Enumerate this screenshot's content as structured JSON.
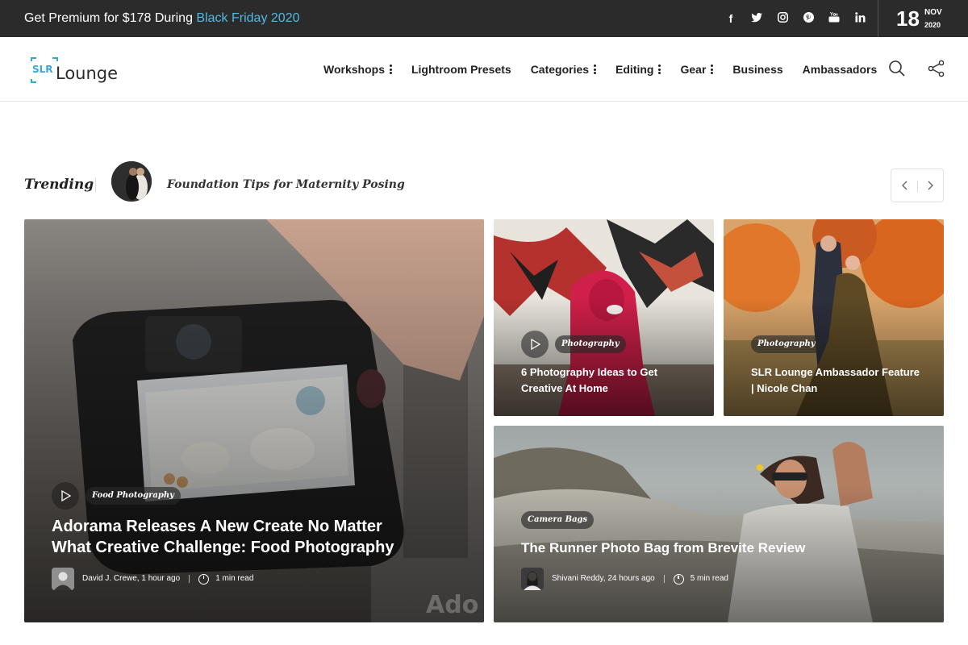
{
  "promo": {
    "text": "Get Premium for $178 During ",
    "highlight": "Black Friday 2020"
  },
  "social": [
    "facebook-icon",
    "twitter-icon",
    "instagram-icon",
    "pinterest-icon",
    "youtube-icon",
    "linkedin-icon"
  ],
  "date": {
    "day": "18",
    "month": "NOV",
    "year": "2020"
  },
  "logo": {
    "badge": "SLR",
    "word": "Lounge"
  },
  "nav": [
    {
      "label": "Workshops",
      "dropdown": true
    },
    {
      "label": "Lightroom Presets",
      "dropdown": false
    },
    {
      "label": "Categories",
      "dropdown": true
    },
    {
      "label": "Editing",
      "dropdown": true
    },
    {
      "label": "Gear",
      "dropdown": true
    },
    {
      "label": "Business",
      "dropdown": false
    },
    {
      "label": "Ambassadors",
      "dropdown": false
    }
  ],
  "trending": {
    "label": "Trending",
    "title": "Foundation Tips for Maternity Posing"
  },
  "cards": {
    "main": {
      "category": "Food Photography",
      "title_line1": "Adorama Releases A New Create No Matter",
      "title_line2": "What Creative Challenge: Food Photography",
      "author": "David J. Crewe,",
      "time": "1 hour ago",
      "read": "1 min read",
      "watermark": "Ado"
    },
    "ideas": {
      "category": "Photography",
      "title_line1": "6 Photography Ideas to Get",
      "title_line2": "Creative At Home"
    },
    "ambassador": {
      "category": "Photography",
      "title_line1": "SLR Lounge Ambassador Feature",
      "title_line2": "| Nicole Chan"
    },
    "runner": {
      "category": "Camera Bags",
      "title": "The Runner Photo Bag from Brevite Review",
      "author": "Shivani Reddy,",
      "time": "24 hours ago",
      "read": "5 min read"
    }
  },
  "colors": {
    "topbar": "#2b2b2b",
    "accent": "#52b8e6",
    "logo": "#3aa6d6"
  }
}
